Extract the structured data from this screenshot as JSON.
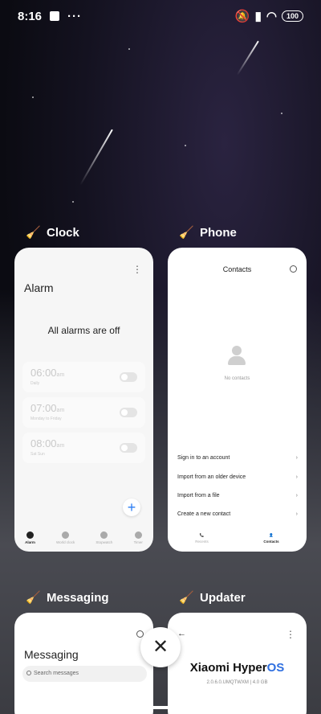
{
  "status_bar": {
    "time": "8:16",
    "battery": "100"
  },
  "apps": [
    {
      "name": "Clock",
      "screen_title": "Alarm",
      "empty_text": "All alarms are off",
      "alarms": [
        {
          "time": "06:00",
          "ampm": "am",
          "repeat": "Daily"
        },
        {
          "time": "07:00",
          "ampm": "am",
          "repeat": "Monday to Friday"
        },
        {
          "time": "08:00",
          "ampm": "am",
          "repeat": "Sat Sun"
        }
      ],
      "tabs": [
        "Alarm",
        "World clock",
        "Stopwatch",
        "Timer"
      ]
    },
    {
      "name": "Phone",
      "screen_title": "Contacts",
      "empty_text": "No contacts",
      "options": [
        "Sign in to an account",
        "Import from an older device",
        "Import from a file",
        "Create a new contact"
      ],
      "tabs": [
        "Recents",
        "Contacts"
      ]
    },
    {
      "name": "Messaging",
      "screen_title": "Messaging",
      "search_placeholder": "Search messages"
    },
    {
      "name": "Updater",
      "brand_part1": "Xiaomi Hyper",
      "brand_part2": "OS",
      "version": "2.0.6.0.UMQTWXM | 4.0 GB"
    }
  ],
  "close_button": "✕"
}
